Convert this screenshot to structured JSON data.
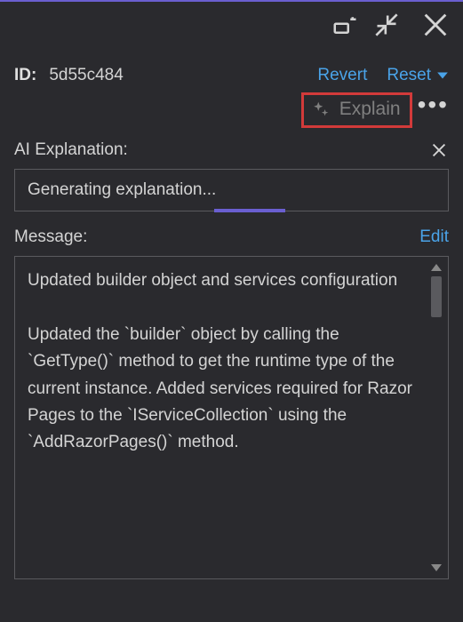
{
  "colors": {
    "accent": "#4aa3e8",
    "highlight_border": "#d23a3a",
    "progress": "#6a5fd0"
  },
  "titlebar": {
    "dock_icon": "dock-panel-icon",
    "minimize_icon": "collapse-arrow-icon",
    "close_icon": "close-icon"
  },
  "commit": {
    "id_label": "ID:",
    "id_value": "5d55c484",
    "revert_label": "Revert",
    "reset_label": "Reset"
  },
  "explain": {
    "button_label": "Explain",
    "more_label": "•••"
  },
  "ai": {
    "section_label": "AI Explanation:",
    "status_text": "Generating explanation..."
  },
  "message": {
    "section_label": "Message:",
    "edit_label": "Edit",
    "body": "Updated builder object and services configuration\n\nUpdated the `builder` object by calling the `GetType()` method to get the runtime type of the current instance. Added services required for Razor Pages to the `IServiceCollection` using the `AddRazorPages()` method."
  }
}
